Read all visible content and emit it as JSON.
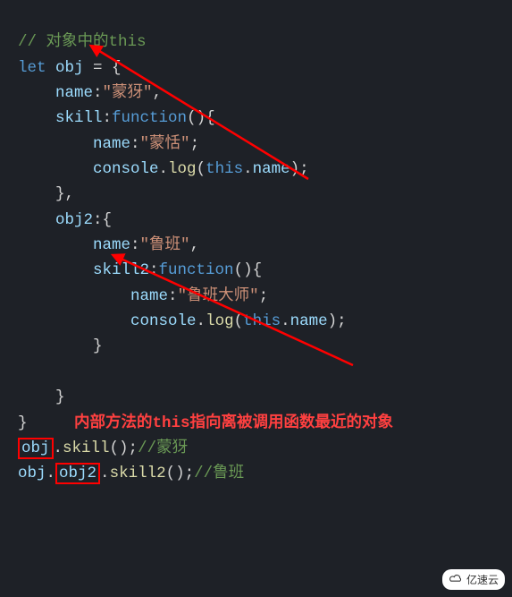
{
  "code": {
    "l1_comment": "// 对象中的this",
    "l2_let": "let",
    "l2_obj": "obj",
    "l2_rest": " = {",
    "l3_name": "name",
    "l3_str": "\"蒙犽\"",
    "l4_skill": "skill",
    "l4_fn": "function",
    "l4_rest": "(){",
    "l5_name": "name",
    "l5_str": "\"蒙恬\"",
    "l6_console": "console",
    "l6_log": "log",
    "l6_this": "this",
    "l6_prop": "name",
    "l7": "},",
    "l8_obj2": "obj2",
    "l8_rest": ":{",
    "l9_name": "name",
    "l9_str": "\"鲁班\"",
    "l10_skill2": "skill2",
    "l10_fn": "function",
    "l10_rest": "(){",
    "l11_name": "name",
    "l11_str": "\"鲁班大师\"",
    "l12_console": "console",
    "l12_log": "log",
    "l12_this": "this",
    "l12_prop": "name",
    "l13": "}",
    "l14": "",
    "l15": "}",
    "l16": "}",
    "note": "内部方法的this指向离被调用函数最近的对象",
    "l17_obj": "obj",
    "l17_skill": "skill",
    "l17_cmt": "//蒙犽",
    "l18_obj": "obj",
    "l18_obj2": "obj2",
    "l18_skill2": "skill2",
    "l18_cmt": "//鲁班"
  },
  "watermark": "亿速云",
  "colors": {
    "arrow": "#ff0000",
    "note": "#ff4040",
    "bg": "#1e2127"
  }
}
